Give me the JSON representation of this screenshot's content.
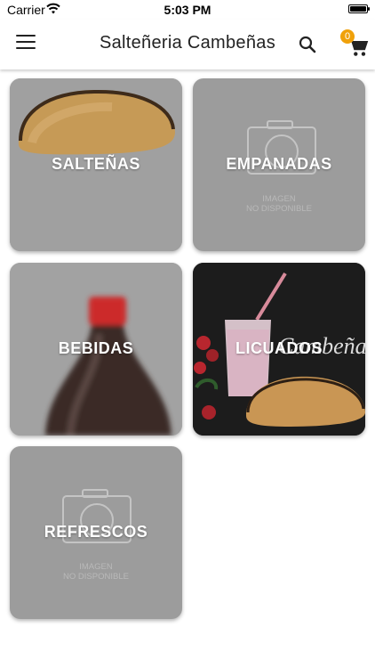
{
  "status_bar": {
    "carrier": "Carrier",
    "time": "5:03 PM"
  },
  "app_bar": {
    "title": "Salteñeria Cambeñas",
    "cart_count": "0"
  },
  "categories": [
    {
      "label": "SALTEÑAS"
    },
    {
      "label": "EMPANADAS",
      "placeholder_line1": "IMAGEN",
      "placeholder_line2": "NO DISPONIBLE"
    },
    {
      "label": "BEBIDAS"
    },
    {
      "label": "LICUADOS",
      "brand_text": "Cambeñas"
    },
    {
      "label": "REFRESCOS",
      "placeholder_line1": "IMAGEN",
      "placeholder_line2": "NO DISPONIBLE"
    }
  ],
  "colors": {
    "badge": "#f0a10a",
    "card_gray": "#9c9c9c"
  }
}
